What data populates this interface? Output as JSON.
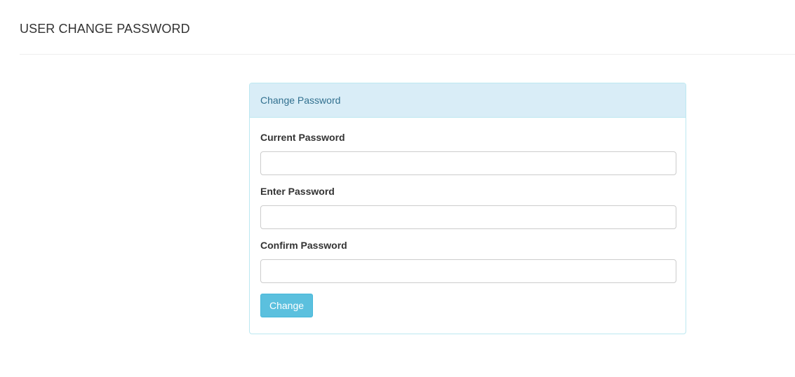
{
  "page": {
    "title": "USER CHANGE PASSWORD"
  },
  "panel": {
    "heading": "Change Password",
    "fields": [
      {
        "label": "Current Password",
        "value": "",
        "placeholder": ""
      },
      {
        "label": "Enter Password",
        "value": "",
        "placeholder": ""
      },
      {
        "label": "Confirm Password",
        "value": "",
        "placeholder": ""
      }
    ],
    "submit_label": "Change"
  },
  "colors": {
    "panel_border": "#bce8f1",
    "panel_heading_bg": "#d9edf7",
    "panel_heading_text": "#31708f",
    "button_bg": "#5bc0de"
  }
}
